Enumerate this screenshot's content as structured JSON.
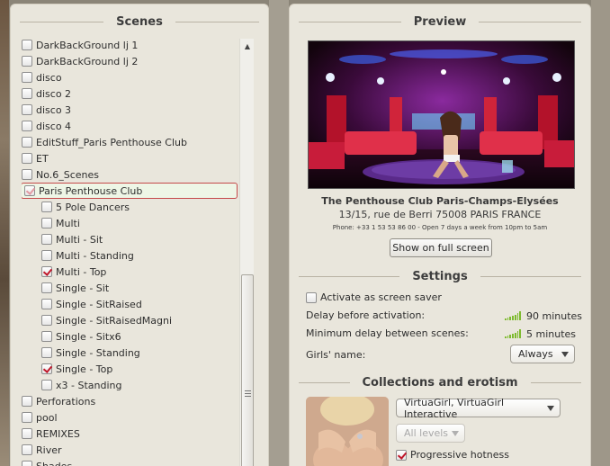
{
  "scenes": {
    "title": "Scenes",
    "items": [
      {
        "label": "DarkBackGround lj 1",
        "checked": false,
        "indent": 0
      },
      {
        "label": "DarkBackGround lj 2",
        "checked": false,
        "indent": 0
      },
      {
        "label": "disco",
        "checked": false,
        "indent": 0
      },
      {
        "label": "disco 2",
        "checked": false,
        "indent": 0
      },
      {
        "label": "disco 3",
        "checked": false,
        "indent": 0
      },
      {
        "label": "disco 4",
        "checked": false,
        "indent": 0
      },
      {
        "label": "EditStuff_Paris Penthouse Club",
        "checked": false,
        "indent": 0
      },
      {
        "label": "ET",
        "checked": false,
        "indent": 0
      },
      {
        "label": "No.6_Scenes",
        "checked": false,
        "indent": 0
      },
      {
        "label": "Paris Penthouse Club",
        "checked": "partial",
        "indent": 0,
        "selected": true
      },
      {
        "label": "5 Pole Dancers",
        "checked": false,
        "indent": 1
      },
      {
        "label": "Multi",
        "checked": false,
        "indent": 1
      },
      {
        "label": "Multi - Sit",
        "checked": false,
        "indent": 1
      },
      {
        "label": "Multi - Standing",
        "checked": false,
        "indent": 1
      },
      {
        "label": "Multi - Top",
        "checked": true,
        "indent": 1
      },
      {
        "label": "Single - Sit",
        "checked": false,
        "indent": 1
      },
      {
        "label": "Single - SitRaised",
        "checked": false,
        "indent": 1
      },
      {
        "label": "Single - SitRaisedMagni",
        "checked": false,
        "indent": 1
      },
      {
        "label": "Single - Sitx6",
        "checked": false,
        "indent": 1
      },
      {
        "label": "Single - Standing",
        "checked": false,
        "indent": 1
      },
      {
        "label": "Single - Top",
        "checked": true,
        "indent": 1
      },
      {
        "label": "x3 - Standing",
        "checked": false,
        "indent": 1
      },
      {
        "label": "Perforations",
        "checked": false,
        "indent": 0
      },
      {
        "label": "pool",
        "checked": false,
        "indent": 0
      },
      {
        "label": "REMIXES",
        "checked": false,
        "indent": 0
      },
      {
        "label": "River",
        "checked": false,
        "indent": 0
      },
      {
        "label": "Shades",
        "checked": false,
        "indent": 0
      }
    ]
  },
  "preview": {
    "title": "Preview",
    "club_name": "The Penthouse Club Paris-Champs-Elysées",
    "address": "13/15, rue de Berri 75008 PARIS FRANCE",
    "phone": "Phone: +33 1 53 53 86 00 - Open 7 days a week from 10pm to 5am",
    "fullscreen_label": "Show on full screen"
  },
  "settings": {
    "title": "Settings",
    "screensaver_label": "Activate as screen saver",
    "screensaver_checked": false,
    "delay_label": "Delay before activation:",
    "delay_value": "90 minutes",
    "min_delay_label": "Minimum delay between scenes:",
    "min_delay_value": "5 minutes",
    "girls_name_label": "Girls' name:",
    "girls_name_value": "Always"
  },
  "collections": {
    "title": "Collections and erotism",
    "collection_value": "VirtuaGirl, VirtuaGirl Interactive",
    "levels_value": "All levels",
    "progressive_label": "Progressive hotness",
    "progressive_checked": true
  },
  "colors": {
    "accent_check": "#c0182a",
    "signal_green": "#7dba2e",
    "panel_bg": "#e9e6dc"
  }
}
